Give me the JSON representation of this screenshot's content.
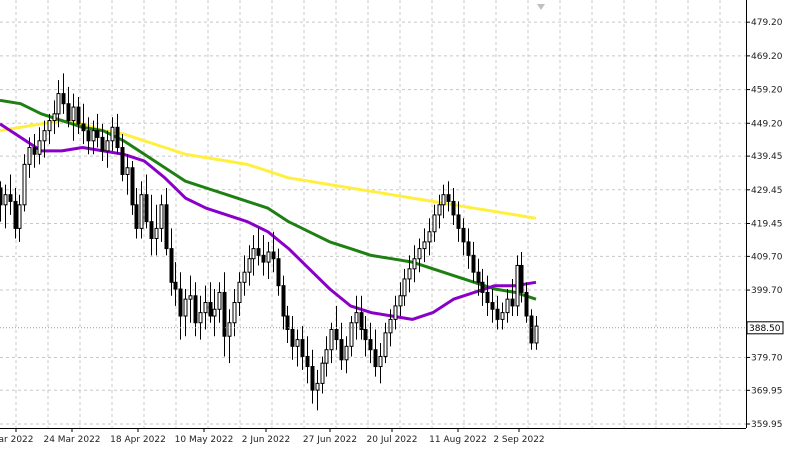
{
  "chart_data": {
    "type": "candlestick",
    "ylim": [
      359.95,
      484.0
    ],
    "grid": true,
    "y_ticks": [
      "479.20",
      "469.20",
      "459.20",
      "449.20",
      "439.45",
      "429.45",
      "419.45",
      "409.70",
      "399.70",
      "388.50",
      "379.70",
      "369.95",
      "359.95"
    ],
    "x_ticks": [
      "ar 2022",
      "24 Mar 2022",
      "18 Apr 2022",
      "10 May 2022",
      "2 Jun 2022",
      "27 Jun 2022",
      "20 Jul 2022",
      "11 Aug 2022",
      "2 Sep 2022"
    ],
    "current_price": "388.50",
    "colors": {
      "candle": "#000000",
      "ma_fast": "#8B00C8",
      "ma_mid": "#1E7F12",
      "ma_slow": "#FFF040",
      "grid": "#C8C8C8",
      "axis": "#000000"
    },
    "candles": [
      [
        430,
        432,
        420,
        425
      ],
      [
        425,
        431,
        418,
        428
      ],
      [
        428,
        434,
        422,
        426
      ],
      [
        426,
        430,
        415,
        418
      ],
      [
        418,
        428,
        414,
        425
      ],
      [
        425,
        440,
        423,
        437
      ],
      [
        437,
        445,
        433,
        442
      ],
      [
        442,
        446,
        436,
        440
      ],
      [
        440,
        448,
        437,
        444
      ],
      [
        444,
        450,
        439,
        447
      ],
      [
        447,
        452,
        443,
        450
      ],
      [
        450,
        456,
        446,
        452
      ],
      [
        452,
        462,
        448,
        458
      ],
      [
        458,
        464,
        452,
        455
      ],
      [
        455,
        460,
        448,
        450
      ],
      [
        450,
        458,
        444,
        454
      ],
      [
        454,
        457,
        446,
        449
      ],
      [
        449,
        455,
        443,
        447
      ],
      [
        447,
        451,
        440,
        444
      ],
      [
        444,
        450,
        440,
        447
      ],
      [
        447,
        452,
        442,
        445
      ],
      [
        445,
        449,
        438,
        441
      ],
      [
        441,
        447,
        436,
        444
      ],
      [
        444,
        451,
        441,
        448
      ],
      [
        448,
        452,
        440,
        442
      ],
      [
        442,
        446,
        432,
        434
      ],
      [
        434,
        440,
        428,
        436
      ],
      [
        436,
        438,
        422,
        425
      ],
      [
        425,
        430,
        415,
        418
      ],
      [
        418,
        432,
        415,
        428
      ],
      [
        428,
        434,
        418,
        420
      ],
      [
        420,
        428,
        410,
        415
      ],
      [
        415,
        425,
        410,
        418
      ],
      [
        418,
        428,
        414,
        425
      ],
      [
        425,
        430,
        410,
        412
      ],
      [
        412,
        418,
        398,
        402
      ],
      [
        402,
        408,
        395,
        400
      ],
      [
        400,
        405,
        385,
        392
      ],
      [
        392,
        400,
        386,
        397
      ],
      [
        397,
        404,
        390,
        398
      ],
      [
        398,
        402,
        386,
        390
      ],
      [
        390,
        398,
        385,
        393
      ],
      [
        393,
        401,
        388,
        396
      ],
      [
        396,
        402,
        390,
        392
      ],
      [
        392,
        400,
        386,
        394
      ],
      [
        394,
        402,
        390,
        399
      ],
      [
        399,
        405,
        380,
        386
      ],
      [
        386,
        394,
        378,
        390
      ],
      [
        390,
        400,
        386,
        396
      ],
      [
        396,
        405,
        392,
        402
      ],
      [
        402,
        410,
        398,
        405
      ],
      [
        405,
        413,
        401,
        409
      ],
      [
        409,
        416,
        404,
        412
      ],
      [
        412,
        418,
        407,
        410
      ],
      [
        410,
        416,
        404,
        408
      ],
      [
        408,
        414,
        403,
        411
      ],
      [
        411,
        417,
        405,
        409
      ],
      [
        409,
        412,
        398,
        401
      ],
      [
        401,
        404,
        388,
        392
      ],
      [
        392,
        395,
        384,
        388
      ],
      [
        388,
        392,
        379,
        383
      ],
      [
        383,
        388,
        377,
        385
      ],
      [
        385,
        389,
        376,
        380
      ],
      [
        380,
        386,
        372,
        377
      ],
      [
        377,
        382,
        366,
        370
      ],
      [
        370,
        376,
        364,
        372
      ],
      [
        372,
        380,
        369,
        378
      ],
      [
        378,
        386,
        374,
        382
      ],
      [
        382,
        390,
        378,
        388
      ],
      [
        388,
        395,
        382,
        385
      ],
      [
        385,
        390,
        376,
        379
      ],
      [
        379,
        386,
        375,
        383
      ],
      [
        383,
        392,
        380,
        390
      ],
      [
        390,
        398,
        385,
        393
      ],
      [
        393,
        398,
        385,
        388
      ],
      [
        388,
        392,
        380,
        385
      ],
      [
        385,
        390,
        378,
        382
      ],
      [
        382,
        388,
        374,
        377
      ],
      [
        377,
        384,
        372,
        380
      ],
      [
        380,
        390,
        378,
        387
      ],
      [
        387,
        394,
        383,
        391
      ],
      [
        391,
        398,
        388,
        395
      ],
      [
        395,
        402,
        392,
        398
      ],
      [
        398,
        406,
        395,
        403
      ],
      [
        403,
        410,
        399,
        406
      ],
      [
        406,
        413,
        402,
        409
      ],
      [
        409,
        415,
        405,
        412
      ],
      [
        412,
        418,
        408,
        414
      ],
      [
        414,
        421,
        410,
        417
      ],
      [
        417,
        425,
        414,
        422
      ],
      [
        422,
        428,
        418,
        425
      ],
      [
        425,
        431,
        421,
        428
      ],
      [
        428,
        432,
        423,
        426
      ],
      [
        426,
        430,
        419,
        422
      ],
      [
        422,
        426,
        414,
        418
      ],
      [
        418,
        421,
        410,
        414
      ],
      [
        414,
        418,
        406,
        410
      ],
      [
        410,
        414,
        402,
        405
      ],
      [
        405,
        409,
        398,
        402
      ],
      [
        402,
        406,
        395,
        399
      ],
      [
        399,
        404,
        392,
        396
      ],
      [
        396,
        400,
        390,
        394
      ],
      [
        394,
        398,
        388,
        391
      ],
      [
        391,
        396,
        388,
        393
      ],
      [
        393,
        400,
        390,
        397
      ],
      [
        397,
        403,
        392,
        395
      ],
      [
        395,
        410,
        392,
        407
      ],
      [
        407,
        411,
        396,
        399
      ],
      [
        399,
        402,
        390,
        392
      ],
      [
        392,
        394,
        382,
        384
      ],
      [
        384,
        392,
        382,
        389
      ]
    ],
    "ma_fast": [
      449,
      445,
      441,
      441,
      442,
      441,
      440,
      438,
      433,
      427,
      424,
      422,
      420,
      417,
      412,
      406,
      400,
      395,
      393,
      392,
      391,
      393,
      397,
      399,
      401,
      401,
      402
    ],
    "ma_mid": [
      456,
      455,
      452,
      450,
      448,
      447,
      444,
      440,
      436,
      432,
      430,
      428,
      426,
      424,
      420,
      417,
      414,
      412,
      410,
      409,
      408,
      406,
      404,
      402,
      400,
      399,
      397
    ],
    "ma_slow": [
      447,
      448,
      449,
      450,
      449,
      447,
      446,
      444,
      442,
      440,
      439,
      438,
      437,
      435,
      433,
      432,
      431,
      430,
      429,
      428,
      427,
      426,
      425,
      424,
      423,
      422,
      421
    ]
  }
}
